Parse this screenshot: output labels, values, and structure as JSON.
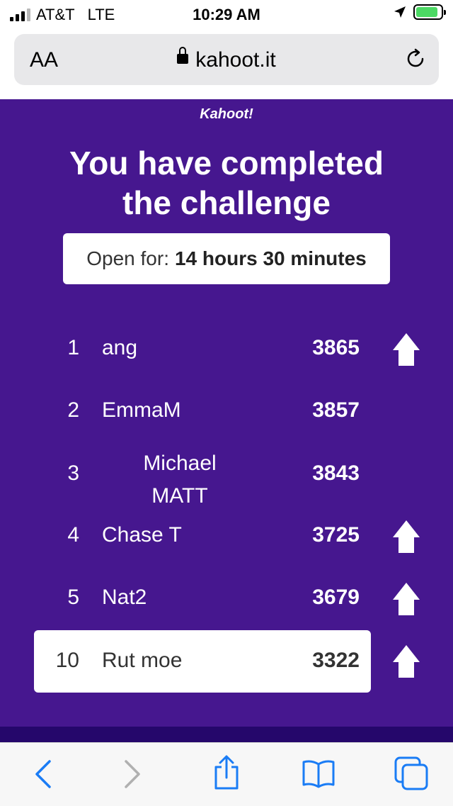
{
  "status_bar": {
    "carrier": "AT&T",
    "network": "LTE",
    "time": "10:29 AM"
  },
  "browser": {
    "text_size_label": "AA",
    "url": "kahoot.it"
  },
  "page": {
    "logo": "Kahoot!",
    "headline_line1": "You have completed",
    "headline_line2": "the challenge",
    "open_label": "Open for:",
    "open_value": "14 hours 30 minutes"
  },
  "leaderboard": [
    {
      "rank": "1",
      "name": "ang",
      "score": "3865",
      "arrow": true
    },
    {
      "rank": "2",
      "name": "EmmaM",
      "score": "3857",
      "arrow": false
    },
    {
      "rank": "3",
      "name_line1": "Michael",
      "name_line2": "MATT",
      "score": "3843",
      "arrow": false
    },
    {
      "rank": "4",
      "name": "Chase T",
      "score": "3725",
      "arrow": true
    },
    {
      "rank": "5",
      "name": "Nat2",
      "score": "3679",
      "arrow": true
    },
    {
      "rank": "10",
      "name": "Rut moe",
      "score": "3322",
      "arrow": true,
      "highlighted": true
    }
  ],
  "colors": {
    "brand_purple": "#46178f",
    "dark_purple": "#25076b",
    "ios_blue": "#1a7cf5"
  },
  "toolbar_icons": [
    "back-icon",
    "forward-icon",
    "share-icon",
    "bookmarks-icon",
    "tabs-icon"
  ]
}
